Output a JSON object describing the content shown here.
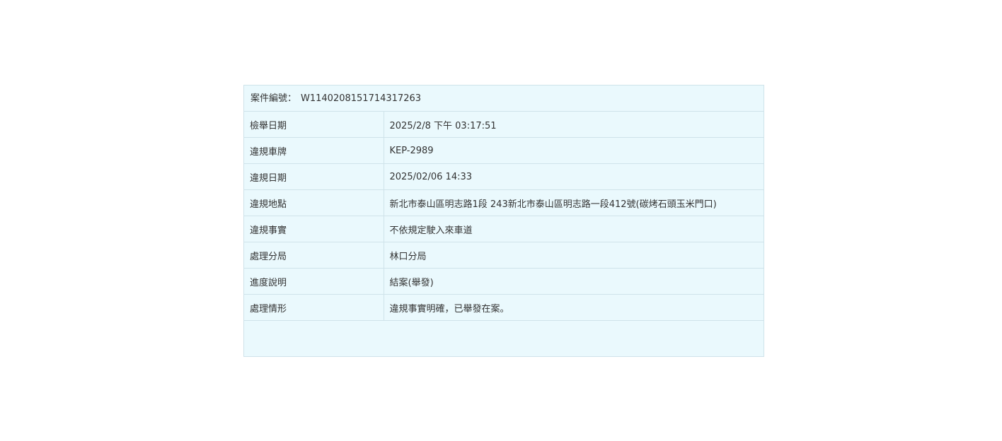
{
  "case": {
    "number_label": "案件編號：",
    "number_value": "W1140208151714317263"
  },
  "rows": [
    {
      "label": "檢舉日期",
      "value": "2025/2/8 下午 03:17:51"
    },
    {
      "label": "違規車牌",
      "value": "KEP-2989"
    },
    {
      "label": "違規日期",
      "value": "2025/02/06 14:33"
    },
    {
      "label": "違規地點",
      "value": "新北市泰山區明志路1段 243新北市泰山區明志路一段412號(碳烤石頭玉米門口)"
    },
    {
      "label": "違規事實",
      "value": "不依規定駛入來車道"
    },
    {
      "label": "處理分局",
      "value": "林口分局"
    },
    {
      "label": "進度說明",
      "value": "結案(舉發)"
    },
    {
      "label": "處理情形",
      "value": "違規事實明確，已舉發在案。"
    }
  ],
  "colors": {
    "panel_background": "#eaf9fd",
    "border": "#cfe3ea",
    "text": "#333333"
  }
}
